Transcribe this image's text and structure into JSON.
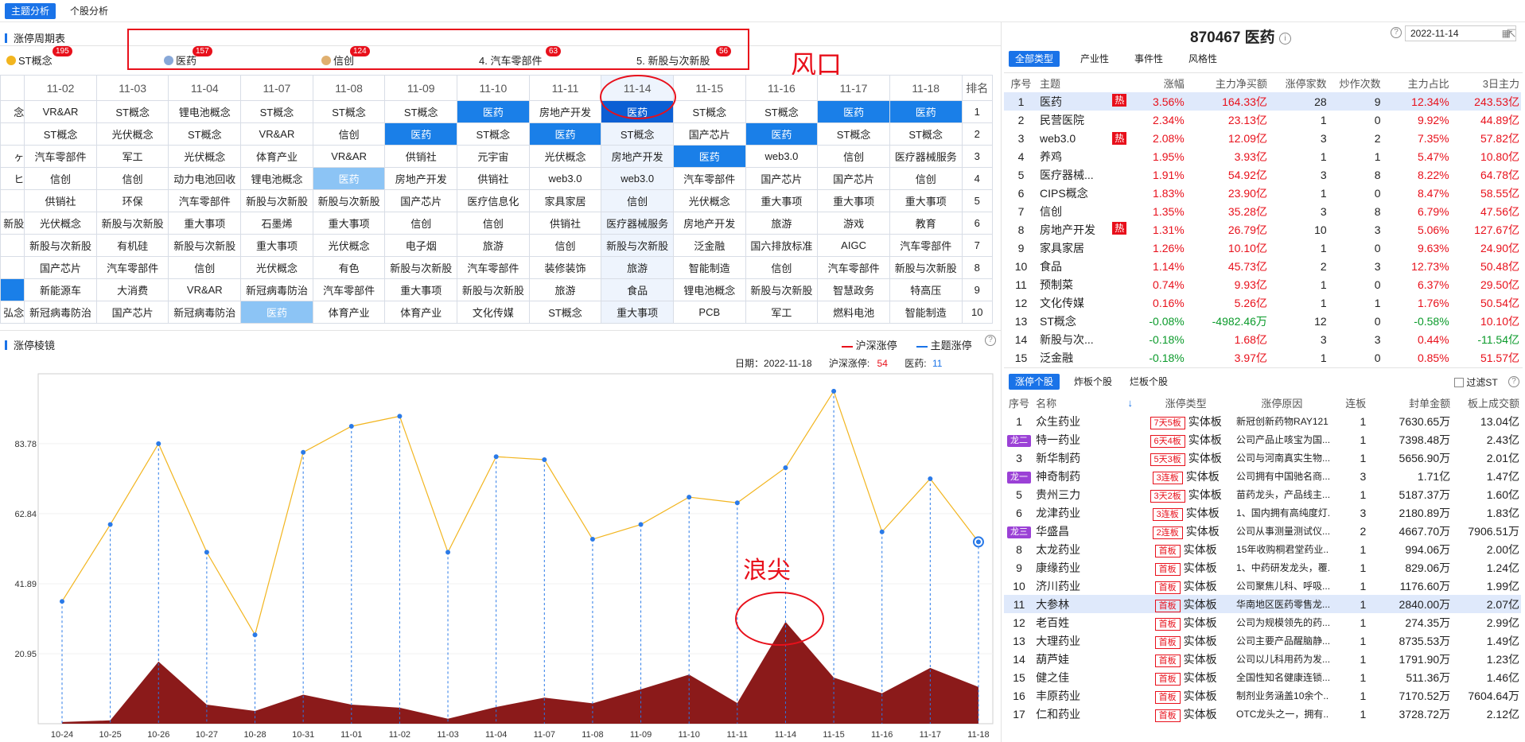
{
  "topbar": {
    "tab1": "主题分析",
    "tab2": "个股分析"
  },
  "cycle": {
    "title": "涨停周期表",
    "themes": [
      {
        "label": "ST概念",
        "count": "195"
      },
      {
        "label": "医药",
        "count": "157"
      },
      {
        "label": "信创",
        "count": "124"
      },
      {
        "label": "4. 汽车零部件",
        "count": "63"
      },
      {
        "label": "5. 新股与次新股",
        "count": "56"
      }
    ],
    "annotation": "风口",
    "rank_header": "排名",
    "dates": [
      "11-02",
      "11-03",
      "11-04",
      "11-07",
      "11-08",
      "11-09",
      "11-10",
      "11-11",
      "11-14",
      "11-15",
      "11-16",
      "11-17",
      "11-18"
    ],
    "edge": [
      "念",
      "",
      "ヶ",
      "ヒ",
      "",
      "新股",
      "",
      "",
      "",
      "弘念"
    ],
    "rows": [
      [
        "VR&AR",
        "ST概念",
        "锂电池概念",
        "ST概念",
        "ST概念",
        "ST概念",
        "医药",
        "房地产开发",
        "医药",
        "ST概念",
        "ST概念",
        "医药",
        "医药"
      ],
      [
        "ST概念",
        "光伏概念",
        "ST概念",
        "VR&AR",
        "信创",
        "医药",
        "ST概念",
        "医药",
        "ST概念",
        "国产芯片",
        "医药",
        "ST概念",
        "ST概念"
      ],
      [
        "汽车零部件",
        "军工",
        "光伏概念",
        "体育产业",
        "VR&AR",
        "供销社",
        "元宇宙",
        "光伏概念",
        "房地产开发",
        "医药",
        "web3.0",
        "信创",
        "医疗器械服务"
      ],
      [
        "信创",
        "信创",
        "动力电池回收",
        "锂电池概念",
        "医药",
        "房地产开发",
        "供销社",
        "web3.0",
        "web3.0",
        "汽车零部件",
        "国产芯片",
        "国产芯片",
        "信创"
      ],
      [
        "供销社",
        "环保",
        "汽车零部件",
        "新股与次新股",
        "新股与次新股",
        "国产芯片",
        "医疗信息化",
        "家具家居",
        "信创",
        "光伏概念",
        "重大事项",
        "重大事项",
        "重大事项"
      ],
      [
        "光伏概念",
        "新股与次新股",
        "重大事项",
        "石墨烯",
        "重大事项",
        "信创",
        "信创",
        "供销社",
        "医疗器械服务",
        "房地产开发",
        "旅游",
        "游戏",
        "教育"
      ],
      [
        "新股与次新股",
        "有机硅",
        "新股与次新股",
        "重大事项",
        "光伏概念",
        "电子烟",
        "旅游",
        "信创",
        "新股与次新股",
        "泛金融",
        "国六排放标准",
        "AIGC",
        "汽车零部件"
      ],
      [
        "国产芯片",
        "汽车零部件",
        "信创",
        "光伏概念",
        "有色",
        "新股与次新股",
        "汽车零部件",
        "装修装饰",
        "旅游",
        "智能制造",
        "信创",
        "汽车零部件",
        "新股与次新股"
      ],
      [
        "新能源车",
        "大消费",
        "VR&AR",
        "新冠病毒防治",
        "汽车零部件",
        "重大事项",
        "新股与次新股",
        "旅游",
        "食品",
        "锂电池概念",
        "新股与次新股",
        "智慧政务",
        "特高压"
      ],
      [
        "新冠病毒防治",
        "国产芯片",
        "新冠病毒防治",
        "医药",
        "体育产业",
        "体育产业",
        "文化传媒",
        "ST概念",
        "重大事项",
        "PCB",
        "军工",
        "燃料电池",
        "智能制造"
      ]
    ],
    "ranks": [
      "1",
      "2",
      "3",
      "4",
      "5",
      "6",
      "7",
      "8",
      "9",
      "10"
    ]
  },
  "mirror": {
    "title": "涨停棱镜",
    "legend1": "沪深涨停",
    "legend2": "主题涨停",
    "date_label": "日期：",
    "date_value": "2022-11-18",
    "hs_label": "沪深涨停:",
    "hs_value": "54",
    "yy_label": "医药:",
    "yy_value": "11",
    "annotation": "浪尖"
  },
  "chart_data": {
    "type": "line",
    "categories": [
      "10-24",
      "10-25",
      "10-26",
      "10-27",
      "10-28",
      "10-31",
      "11-01",
      "11-02",
      "11-03",
      "11-04",
      "11-07",
      "11-08",
      "11-09",
      "11-10",
      "11-11",
      "11-14",
      "11-15",
      "11-16",
      "11-17",
      "11-18"
    ],
    "y_ticks": [
      "20.95",
      "41.89",
      "62.84",
      "83.78"
    ],
    "ylim": [
      0,
      104.7
    ],
    "series": [
      {
        "name": "沪深涨停",
        "type": "line",
        "color": "#f2b51f",
        "values": [
          36.6,
          59.6,
          83.8,
          51.3,
          26.6,
          81.2,
          89.0,
          92.0,
          51.3,
          79.9,
          79.0,
          55.2,
          59.6,
          67.8,
          66.1,
          76.6,
          99.5,
          57.4,
          73.3,
          54.4
        ]
      },
      {
        "name": "主题涨停",
        "type": "area",
        "color": "#8b1a1a",
        "values": [
          0.5,
          1.0,
          18.6,
          5.7,
          3.8,
          8.7,
          5.7,
          4.8,
          1.5,
          5.0,
          7.8,
          6.1,
          10.3,
          14.7,
          6.2,
          30.5,
          13.8,
          9.1,
          16.7,
          11.0
        ]
      }
    ]
  },
  "stock": {
    "code_name": "870467 医药",
    "date_value": "2022-11-14",
    "tabs": [
      "全部类型",
      "产业性",
      "事件性",
      "风格性"
    ],
    "headers": [
      "序号",
      "主题",
      "涨幅",
      "主力净买额",
      "涨停家数",
      "炒作次数",
      "主力占比",
      "3日主力"
    ],
    "hot_label": "热",
    "rows": [
      [
        "1",
        "医药",
        true,
        "3.56%",
        "164.33亿",
        "28",
        "9",
        "12.34%",
        "243.53亿"
      ],
      [
        "2",
        "民营医院",
        false,
        "2.34%",
        "23.13亿",
        "1",
        "0",
        "9.92%",
        "44.89亿"
      ],
      [
        "3",
        "web3.0",
        true,
        "2.08%",
        "12.09亿",
        "3",
        "2",
        "7.35%",
        "57.82亿"
      ],
      [
        "4",
        "养鸡",
        false,
        "1.95%",
        "3.93亿",
        "1",
        "1",
        "5.47%",
        "10.80亿"
      ],
      [
        "5",
        "医疗器械...",
        false,
        "1.91%",
        "54.92亿",
        "3",
        "8",
        "8.22%",
        "64.78亿"
      ],
      [
        "6",
        "CIPS概念",
        false,
        "1.83%",
        "23.90亿",
        "1",
        "0",
        "8.47%",
        "58.55亿"
      ],
      [
        "7",
        "信创",
        false,
        "1.35%",
        "35.28亿",
        "3",
        "8",
        "6.79%",
        "47.56亿"
      ],
      [
        "8",
        "房地产开发",
        true,
        "1.31%",
        "26.79亿",
        "10",
        "3",
        "5.06%",
        "127.67亿"
      ],
      [
        "9",
        "家具家居",
        false,
        "1.26%",
        "10.10亿",
        "1",
        "0",
        "9.63%",
        "24.90亿"
      ],
      [
        "10",
        "食品",
        false,
        "1.14%",
        "45.73亿",
        "2",
        "3",
        "12.73%",
        "50.48亿"
      ],
      [
        "11",
        "预制菜",
        false,
        "0.74%",
        "9.93亿",
        "1",
        "0",
        "6.37%",
        "29.50亿"
      ],
      [
        "12",
        "文化传媒",
        false,
        "0.16%",
        "5.26亿",
        "1",
        "1",
        "1.76%",
        "50.54亿"
      ],
      [
        "13",
        "ST概念",
        false,
        "-0.08%",
        "-4982.46万",
        "12",
        "0",
        "-0.58%",
        "10.10亿"
      ],
      [
        "14",
        "新股与次...",
        false,
        "-0.18%",
        "1.68亿",
        "3",
        "3",
        "0.44%",
        "-11.54亿"
      ],
      [
        "15",
        "泛金融",
        false,
        "-0.18%",
        "3.97亿",
        "1",
        "0",
        "0.85%",
        "51.57亿"
      ]
    ]
  },
  "limit": {
    "tabs": [
      "涨停个股",
      "炸板个股",
      "烂板个股"
    ],
    "filter_label": "过滤ST",
    "headers": [
      "序号",
      "名称",
      "↓",
      "涨停类型",
      "涨停原因",
      "连板",
      "封单金额",
      "板上成交额"
    ],
    "rows": [
      [
        "1",
        "",
        "众生药业",
        "7天5板",
        "实体板",
        "新冠创新药物RAY121...",
        "1",
        "7630.65万",
        "13.04亿"
      ],
      [
        "2",
        "龙二",
        "特一药业",
        "6天4板",
        "实体板",
        "公司产品止咳宝为国...",
        "1",
        "7398.48万",
        "2.43亿"
      ],
      [
        "3",
        "",
        "新华制药",
        "5天3板",
        "实体板",
        "公司与河南真实生物...",
        "1",
        "5656.90万",
        "2.01亿"
      ],
      [
        "4",
        "龙一",
        "神奇制药",
        "3连板",
        "实体板",
        "公司拥有中国驰名商...",
        "3",
        "1.71亿",
        "1.47亿"
      ],
      [
        "5",
        "",
        "贵州三力",
        "3天2板",
        "实体板",
        "苗药龙头，产品线主...",
        "1",
        "5187.37万",
        "1.60亿"
      ],
      [
        "6",
        "",
        "龙津药业",
        "3连板",
        "实体板",
        "1、国内拥有高纯度灯...",
        "3",
        "2180.89万",
        "1.83亿"
      ],
      [
        "7",
        "龙三",
        "华盛昌",
        "2连板",
        "实体板",
        "公司从事测量测试仪...",
        "2",
        "4667.70万",
        "7906.51万"
      ],
      [
        "8",
        "",
        "太龙药业",
        "首板",
        "实体板",
        "15年收购桐君堂药业...",
        "1",
        "994.06万",
        "2.00亿"
      ],
      [
        "9",
        "",
        "康缘药业",
        "首板",
        "实体板",
        "1、中药研发龙头，覆...",
        "1",
        "829.06万",
        "1.24亿"
      ],
      [
        "10",
        "",
        "济川药业",
        "首板",
        "实体板",
        "公司聚焦儿科、呼吸...",
        "1",
        "1176.60万",
        "1.99亿"
      ],
      [
        "11",
        "",
        "大参林",
        "首板",
        "实体板",
        "华南地区医药零售龙...",
        "1",
        "2840.00万",
        "2.07亿"
      ],
      [
        "12",
        "",
        "老百姓",
        "首板",
        "实体板",
        "公司为规模领先的药...",
        "1",
        "274.35万",
        "2.99亿"
      ],
      [
        "13",
        "",
        "大理药业",
        "首板",
        "实体板",
        "公司主要产品醒脑静...",
        "1",
        "8735.53万",
        "1.49亿"
      ],
      [
        "14",
        "",
        "葫芦娃",
        "首板",
        "实体板",
        "公司以儿科用药为发...",
        "1",
        "1791.90万",
        "1.23亿"
      ],
      [
        "15",
        "",
        "健之佳",
        "首板",
        "实体板",
        "全国性知名健康连锁...",
        "1",
        "511.36万",
        "1.46亿"
      ],
      [
        "16",
        "",
        "丰原药业",
        "首板",
        "实体板",
        "制剂业务涵盖10余个...",
        "1",
        "7170.52万",
        "7604.64万"
      ],
      [
        "17",
        "",
        "仁和药业",
        "首板",
        "实体板",
        "OTC龙头之一，拥有...",
        "1",
        "3728.72万",
        "2.12亿"
      ]
    ]
  }
}
